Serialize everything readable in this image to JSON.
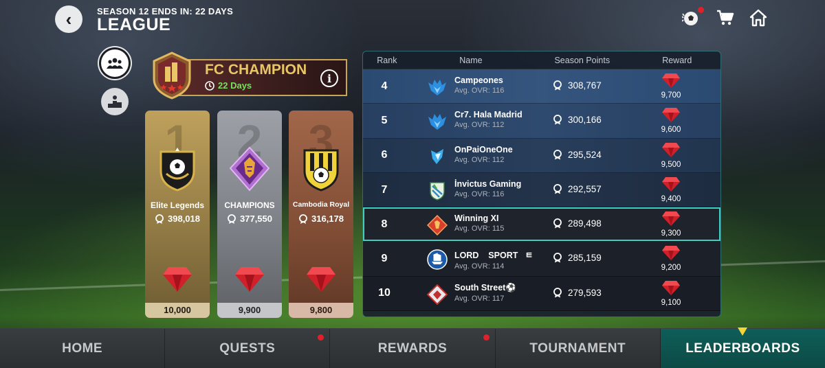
{
  "header": {
    "season_text": "SEASON 12 ENDS IN: 22 DAYS",
    "title": "LEAGUE",
    "back_icon": "chevron-left-icon",
    "top_icons": [
      "ball-notification-icon",
      "cart-icon",
      "home-icon"
    ]
  },
  "champion": {
    "title": "FC CHAMPION",
    "days": "22 Days",
    "info_label": "i"
  },
  "podium": [
    {
      "place": "1",
      "name": "Elite Legends",
      "points": "398,018",
      "reward": "10,000"
    },
    {
      "place": "2",
      "name": "CHAMPIONS",
      "points": "377,550",
      "reward": "9,900"
    },
    {
      "place": "3",
      "name": "Cambodia Royal",
      "points": "316,178",
      "reward": "9,800"
    }
  ],
  "board": {
    "headers": {
      "rank": "Rank",
      "name": "Name",
      "points": "Season Points",
      "reward": "Reward"
    },
    "rows": [
      {
        "rank": "4",
        "name": "Campeones",
        "ovr": "Avg. OVR: 116",
        "points": "308,767",
        "reward": "9,700",
        "crest": "eagle-blue"
      },
      {
        "rank": "5",
        "name": "Cr7. Hala Madrid",
        "ovr": "Avg. OVR: 112",
        "points": "300,166",
        "reward": "9,600",
        "crest": "eagle-blue"
      },
      {
        "rank": "6",
        "name": "OnPaiOneOne",
        "ovr": "Avg. OVR: 112",
        "points": "295,524",
        "reward": "9,500",
        "crest": "wolf-blue"
      },
      {
        "rank": "7",
        "name": "İnvictus Gaming",
        "ovr": "Avg. OVR: 116",
        "points": "292,557",
        "reward": "9,400",
        "crest": "shield-green"
      },
      {
        "rank": "8",
        "name": "Winning XI",
        "ovr": "Avg. OVR: 115",
        "points": "289,498",
        "reward": "9,300",
        "crest": "diamond-red"
      },
      {
        "rank": "9",
        "name": "LORD    SPORT   ㅌ",
        "ovr": "Avg. OVR: 114",
        "points": "285,159",
        "reward": "9,200",
        "crest": "ship-blue"
      },
      {
        "rank": "10",
        "name": "South Street⚽",
        "ovr": "Avg. OVR: 117",
        "points": "279,593",
        "reward": "9,100",
        "crest": "diamond-white"
      }
    ]
  },
  "nav": {
    "tabs": [
      {
        "label": "HOME",
        "dot": false
      },
      {
        "label": "QUESTS",
        "dot": true
      },
      {
        "label": "REWARDS",
        "dot": true
      },
      {
        "label": "TOURNAMENT",
        "dot": false
      },
      {
        "label": "LEADERBOARDS",
        "dot": false
      }
    ],
    "active": "LEADERBOARDS"
  },
  "colors": {
    "gold": "#e9c766",
    "days_green": "#78e060",
    "highlight": "#3ed0c0",
    "gem_red": "#e0202a"
  }
}
